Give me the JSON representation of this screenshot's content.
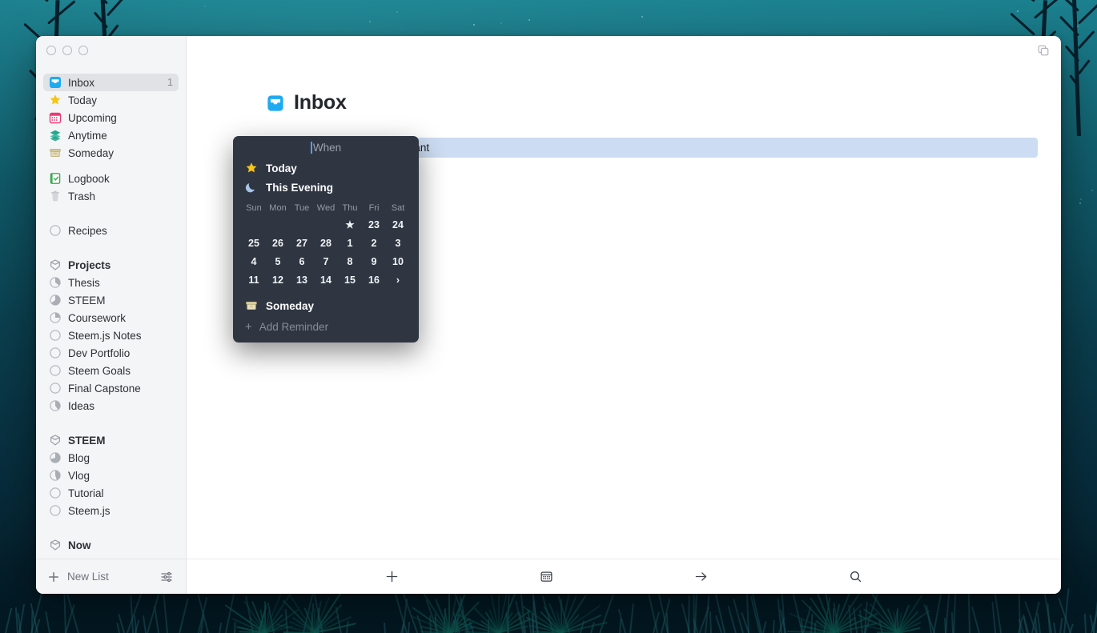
{
  "window": {
    "traffic_lights": [
      "close",
      "minimize",
      "zoom"
    ],
    "top_right_icon": "duplicate-windows-icon"
  },
  "sidebar": {
    "primary_items": [
      {
        "label": "Inbox",
        "icon": "inbox-icon",
        "count": "1",
        "selected": true
      },
      {
        "label": "Today",
        "icon": "star-icon",
        "count": "",
        "selected": false
      },
      {
        "label": "Upcoming",
        "icon": "calendar-icon",
        "count": "",
        "selected": false
      },
      {
        "label": "Anytime",
        "icon": "layers-icon",
        "count": "",
        "selected": false
      },
      {
        "label": "Someday",
        "icon": "box-icon",
        "count": "",
        "selected": false
      }
    ],
    "secondary_items": [
      {
        "label": "Logbook",
        "icon": "logbook-icon",
        "count": ""
      },
      {
        "label": "Trash",
        "icon": "trash-icon",
        "count": ""
      }
    ],
    "loose_items": [
      {
        "label": "Recipes",
        "icon": "progress-empty-icon",
        "progress": 0
      }
    ],
    "groups": [
      {
        "title": "Projects",
        "icon": "area-icon",
        "items": [
          {
            "label": "Thesis",
            "icon": "progress-icon",
            "progress": 35
          },
          {
            "label": "STEEM",
            "icon": "progress-icon",
            "progress": 65
          },
          {
            "label": "Coursework",
            "icon": "progress-icon",
            "progress": 25
          },
          {
            "label": "Steem.js Notes",
            "icon": "progress-icon",
            "progress": 0
          },
          {
            "label": "Dev Portfolio",
            "icon": "progress-icon",
            "progress": 0
          },
          {
            "label": "Steem Goals",
            "icon": "progress-icon",
            "progress": 0
          },
          {
            "label": "Final Capstone",
            "icon": "progress-icon",
            "progress": 0
          },
          {
            "label": "Ideas",
            "icon": "progress-icon",
            "progress": 40
          }
        ]
      },
      {
        "title": "STEEM",
        "icon": "area-icon",
        "items": [
          {
            "label": "Blog",
            "icon": "progress-icon",
            "progress": 70
          },
          {
            "label": "Vlog",
            "icon": "progress-icon",
            "progress": 45
          },
          {
            "label": "Tutorial",
            "icon": "progress-icon",
            "progress": 0
          },
          {
            "label": "Steem.js",
            "icon": "progress-icon",
            "progress": 0
          }
        ]
      },
      {
        "title": "Now",
        "icon": "area-icon",
        "items": []
      }
    ],
    "footer": {
      "new_list_label": "New List",
      "new_list_icon": "plus-icon",
      "settings_icon": "sliders-icon"
    }
  },
  "main": {
    "title": "Inbox",
    "title_icon": "inbox-icon",
    "tasks": [
      {
        "text": "do something really important",
        "selected": true,
        "checked": false
      }
    ],
    "footer_buttons": [
      {
        "icon": "plus-icon",
        "name": "new-todo-button"
      },
      {
        "icon": "calendar-icon",
        "name": "schedule-button"
      },
      {
        "icon": "arrow-right-icon",
        "name": "move-button"
      },
      {
        "icon": "search-icon",
        "name": "search-button"
      }
    ]
  },
  "when_popover": {
    "placeholder": "When",
    "value": "",
    "quick_options": [
      {
        "label": "Today",
        "icon": "star-icon"
      },
      {
        "label": "This Evening",
        "icon": "moon-icon"
      }
    ],
    "calendar": {
      "weekday_headers": [
        "Sun",
        "Mon",
        "Tue",
        "Wed",
        "Thu",
        "Fri",
        "Sat"
      ],
      "weeks": [
        [
          "",
          "",
          "",
          "",
          "★",
          "23",
          "24"
        ],
        [
          "25",
          "26",
          "27",
          "28",
          "1",
          "2",
          "3"
        ],
        [
          "4",
          "5",
          "6",
          "7",
          "8",
          "9",
          "10"
        ],
        [
          "11",
          "12",
          "13",
          "14",
          "15",
          "16",
          "›"
        ]
      ],
      "today_marker": "★",
      "next_marker": "›"
    },
    "someday": {
      "label": "Someday",
      "icon": "box-icon"
    },
    "add_reminder": {
      "label": "Add Reminder",
      "icon": "plus-icon"
    }
  },
  "colors": {
    "accent_blue": "#2196f3",
    "selection_blue": "#ccdcf2",
    "popover_bg": "#2f3642",
    "sidebar_bg": "#f4f5f7",
    "star_yellow": "#f5c518",
    "someday_tan": "#d8cfa4",
    "wallpaper_teal": "#12606f"
  }
}
